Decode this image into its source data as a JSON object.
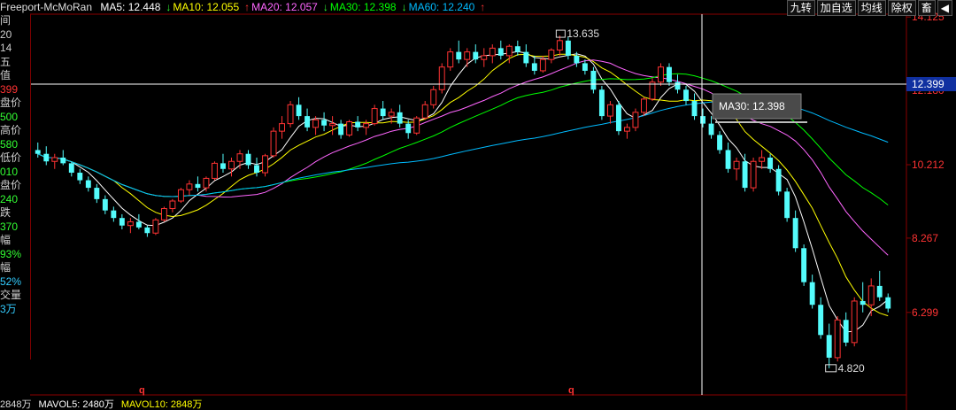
{
  "header": {
    "stock_name": "Freeport-McMoRan",
    "ma_values": [
      {
        "label": "MA5: 12.448",
        "arrow": "↓",
        "color": "#ffffff"
      },
      {
        "label": "MA10: 12.055",
        "arrow": "↑",
        "color": "#ffff00"
      },
      {
        "label": "MA20: 12.057",
        "arrow": "↓",
        "color": "#ff66ff"
      },
      {
        "label": "MA30: 12.398",
        "arrow": "↓",
        "color": "#00ff00"
      },
      {
        "label": "MA60: 12.240",
        "arrow": "↑",
        "color": "#00bbff"
      }
    ]
  },
  "toolbar": {
    "buttons": [
      "九转",
      "加自选",
      "均线",
      "除权",
      "畜"
    ],
    "arrow": "◀"
  },
  "left_panel": [
    {
      "text": "间",
      "color": "#cccccc"
    },
    {
      "text": "20",
      "color": "#cccccc"
    },
    {
      "text": "14",
      "color": "#cccccc"
    },
    {
      "text": "五",
      "color": "#cccccc"
    },
    {
      "text": "值",
      "color": "#cccccc"
    },
    {
      "text": "399",
      "color": "#ff3333"
    },
    {
      "text": "盘价",
      "color": "#cccccc"
    },
    {
      "text": "500",
      "color": "#33ff33"
    },
    {
      "text": "高价",
      "color": "#cccccc"
    },
    {
      "text": "580",
      "color": "#33ff33"
    },
    {
      "text": "低价",
      "color": "#cccccc"
    },
    {
      "text": "010",
      "color": "#33ff33"
    },
    {
      "text": "盘价",
      "color": "#cccccc"
    },
    {
      "text": "240",
      "color": "#33ff33"
    },
    {
      "text": "跌",
      "color": "#cccccc"
    },
    {
      "text": "370",
      "color": "#33ff33"
    },
    {
      "text": "幅",
      "color": "#cccccc"
    },
    {
      "text": "93%",
      "color": "#33ff33"
    },
    {
      "text": "幅",
      "color": "#cccccc"
    },
    {
      "text": "52%",
      "color": "#33ccff"
    },
    {
      "text": "交量",
      "color": "#cccccc"
    },
    {
      "text": "3万",
      "color": "#33ccff"
    }
  ],
  "bottom_bar": {
    "items": [
      "2848万",
      "MAVOL5: 2480万",
      "MAVOL10: 2848万"
    ],
    "markers": [
      "q",
      "q"
    ]
  },
  "crosshair": {
    "price_label": "12.399",
    "tooltip": "MA30: 12.398"
  },
  "chart_data": {
    "type": "candlestick",
    "y_axis_ticks": [
      "14.125",
      "12.180",
      "10.212",
      "8.267",
      "6.299"
    ],
    "ylim": [
      4.3,
      14.2
    ],
    "annotations": {
      "high": "13.635",
      "low": "4.820"
    },
    "candles": [
      [
        10.6,
        10.8,
        10.4,
        10.5
      ],
      [
        10.5,
        10.7,
        10.2,
        10.3
      ],
      [
        10.3,
        10.5,
        10.1,
        10.4
      ],
      [
        10.4,
        10.6,
        10.2,
        10.25
      ],
      [
        10.25,
        10.3,
        9.9,
        10.0
      ],
      [
        10.0,
        10.1,
        9.7,
        9.8
      ],
      [
        9.8,
        9.9,
        9.5,
        9.6
      ],
      [
        9.6,
        9.7,
        9.2,
        9.3
      ],
      [
        9.3,
        9.4,
        8.9,
        9.0
      ],
      [
        9.0,
        9.1,
        8.7,
        8.8
      ],
      [
        8.8,
        8.9,
        8.5,
        8.6
      ],
      [
        8.6,
        8.8,
        8.4,
        8.7
      ],
      [
        8.7,
        8.9,
        8.5,
        8.55
      ],
      [
        8.55,
        8.6,
        8.3,
        8.4
      ],
      [
        8.4,
        8.8,
        8.35,
        8.75
      ],
      [
        8.75,
        9.1,
        8.7,
        9.05
      ],
      [
        9.05,
        9.3,
        8.95,
        9.25
      ],
      [
        9.25,
        9.6,
        9.2,
        9.55
      ],
      [
        9.55,
        9.8,
        9.4,
        9.7
      ],
      [
        9.7,
        9.9,
        9.5,
        9.6
      ],
      [
        9.6,
        9.9,
        9.5,
        9.85
      ],
      [
        9.85,
        10.3,
        9.8,
        10.25
      ],
      [
        10.25,
        10.5,
        10.0,
        10.1
      ],
      [
        10.1,
        10.4,
        9.9,
        10.3
      ],
      [
        10.3,
        10.6,
        10.1,
        10.5
      ],
      [
        10.5,
        10.6,
        10.1,
        10.2
      ],
      [
        10.2,
        10.4,
        9.9,
        10.0
      ],
      [
        10.0,
        10.5,
        9.9,
        10.45
      ],
      [
        10.45,
        11.2,
        10.4,
        11.1
      ],
      [
        11.1,
        11.5,
        10.9,
        11.3
      ],
      [
        11.3,
        11.9,
        11.2,
        11.8
      ],
      [
        11.8,
        12.0,
        11.4,
        11.5
      ],
      [
        11.5,
        11.7,
        11.1,
        11.2
      ],
      [
        11.2,
        11.5,
        11.0,
        11.4
      ],
      [
        11.4,
        11.6,
        11.1,
        11.25
      ],
      [
        11.25,
        11.5,
        11.0,
        11.3
      ],
      [
        11.3,
        11.4,
        10.9,
        11.0
      ],
      [
        11.0,
        11.4,
        10.95,
        11.35
      ],
      [
        11.35,
        11.5,
        11.1,
        11.2
      ],
      [
        11.2,
        11.4,
        11.0,
        11.3
      ],
      [
        11.3,
        11.8,
        11.25,
        11.7
      ],
      [
        11.7,
        11.9,
        11.4,
        11.5
      ],
      [
        11.5,
        11.7,
        11.3,
        11.6
      ],
      [
        11.6,
        11.8,
        11.2,
        11.3
      ],
      [
        11.3,
        11.4,
        10.9,
        11.05
      ],
      [
        11.05,
        11.5,
        11.0,
        11.45
      ],
      [
        11.45,
        11.9,
        11.4,
        11.8
      ],
      [
        11.8,
        12.3,
        11.7,
        12.2
      ],
      [
        12.2,
        12.9,
        12.1,
        12.8
      ],
      [
        12.8,
        13.3,
        12.7,
        13.2
      ],
      [
        13.2,
        13.5,
        12.9,
        13.0
      ],
      [
        13.0,
        13.3,
        12.8,
        13.2
      ],
      [
        13.2,
        13.4,
        12.9,
        13.0
      ],
      [
        13.0,
        13.3,
        12.8,
        13.1
      ],
      [
        13.1,
        13.4,
        12.9,
        13.3
      ],
      [
        13.3,
        13.5,
        13.0,
        13.1
      ],
      [
        13.1,
        13.4,
        12.9,
        13.35
      ],
      [
        13.35,
        13.5,
        13.1,
        13.2
      ],
      [
        13.2,
        13.4,
        12.8,
        12.9
      ],
      [
        12.9,
        13.1,
        12.6,
        12.7
      ],
      [
        12.7,
        13.1,
        12.65,
        13.0
      ],
      [
        13.0,
        13.3,
        12.9,
        13.25
      ],
      [
        13.25,
        13.635,
        13.1,
        13.5
      ],
      [
        13.5,
        13.6,
        13.0,
        13.1
      ],
      [
        13.1,
        13.2,
        12.8,
        12.9
      ],
      [
        12.9,
        13.0,
        12.6,
        12.7
      ],
      [
        12.7,
        12.8,
        12.1,
        12.2
      ],
      [
        12.2,
        12.3,
        11.4,
        11.5
      ],
      [
        11.5,
        11.9,
        11.3,
        11.8
      ],
      [
        11.8,
        11.9,
        11.0,
        11.1
      ],
      [
        11.1,
        11.3,
        10.9,
        11.2
      ],
      [
        11.2,
        11.7,
        11.1,
        11.6
      ],
      [
        11.6,
        12.0,
        11.5,
        11.95
      ],
      [
        11.95,
        12.5,
        11.9,
        12.4
      ],
      [
        12.4,
        12.9,
        12.3,
        12.8
      ],
      [
        12.8,
        12.9,
        12.3,
        12.4
      ],
      [
        12.4,
        12.6,
        12.1,
        12.2
      ],
      [
        12.2,
        12.3,
        11.8,
        11.9
      ],
      [
        11.9,
        12.1,
        11.4,
        11.5
      ],
      [
        11.5,
        11.7,
        11.2,
        11.3
      ],
      [
        11.3,
        11.5,
        10.9,
        11.0
      ],
      [
        11.0,
        11.1,
        10.5,
        10.6
      ],
      [
        10.6,
        10.8,
        10.0,
        10.1
      ],
      [
        10.1,
        10.4,
        9.8,
        10.3
      ],
      [
        10.3,
        10.5,
        9.5,
        9.6
      ],
      [
        9.6,
        10.4,
        9.5,
        10.3
      ],
      [
        10.3,
        10.6,
        10.1,
        10.4
      ],
      [
        10.4,
        10.5,
        10.0,
        10.1
      ],
      [
        10.1,
        10.2,
        9.4,
        9.5
      ],
      [
        9.5,
        9.6,
        8.7,
        8.8
      ],
      [
        8.8,
        9.0,
        7.9,
        8.0
      ],
      [
        8.0,
        8.1,
        7.0,
        7.1
      ],
      [
        7.1,
        7.3,
        6.4,
        6.5
      ],
      [
        6.5,
        6.7,
        5.6,
        5.7
      ],
      [
        5.7,
        6.0,
        4.82,
        5.1
      ],
      [
        5.1,
        6.2,
        5.0,
        6.1
      ],
      [
        6.1,
        6.3,
        5.4,
        5.5
      ],
      [
        5.5,
        6.7,
        5.4,
        6.6
      ],
      [
        6.6,
        7.1,
        6.3,
        6.5
      ],
      [
        6.5,
        7.2,
        6.2,
        7.0
      ],
      [
        7.0,
        7.4,
        6.6,
        6.7
      ],
      [
        6.7,
        6.8,
        6.3,
        6.4
      ]
    ],
    "ma_series": [
      {
        "name": "MA5",
        "color": "#ffffff"
      },
      {
        "name": "MA10",
        "color": "#ffff00"
      },
      {
        "name": "MA20",
        "color": "#ff66ff"
      },
      {
        "name": "MA30",
        "color": "#00ff00"
      },
      {
        "name": "MA60",
        "color": "#00bbff"
      }
    ]
  }
}
